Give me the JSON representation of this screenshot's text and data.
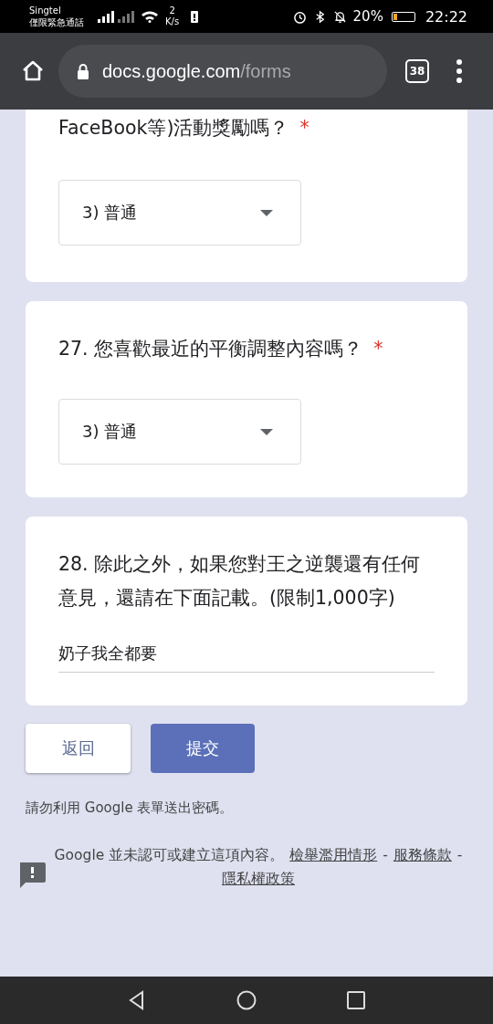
{
  "status_bar": {
    "carrier": "Singtel",
    "carrier_note": "僅限緊急通話",
    "speed_value": "2",
    "speed_unit": "K/s",
    "battery_percent": "20%",
    "time": "22:22"
  },
  "browser_bar": {
    "url_host": "docs.google.com",
    "url_path": "/forms",
    "tab_count": "38"
  },
  "required_mark": "*",
  "questions": [
    {
      "kind": "dropdown",
      "title": "FaceBook等)活動獎勵嗎？",
      "required": true,
      "value": "3) 普通"
    },
    {
      "kind": "dropdown",
      "title": "27. 您喜歡最近的平衡調整內容嗎？",
      "required": true,
      "value": "3) 普通"
    },
    {
      "kind": "text",
      "title": "28. 除此之外，如果您對王之逆襲還有任何意見，還請在下面記載。(限制1,000字)",
      "required": false,
      "value": "奶子我全都要"
    }
  ],
  "buttons": {
    "back": "返回",
    "submit": "提交"
  },
  "password_note": "請勿利用 Google 表單送出密碼。",
  "footer": {
    "text": "Google 並未認可或建立這項內容。",
    "links": [
      "檢舉濫用情形",
      "服務條款",
      "隱私權政策"
    ],
    "separator": "-"
  }
}
